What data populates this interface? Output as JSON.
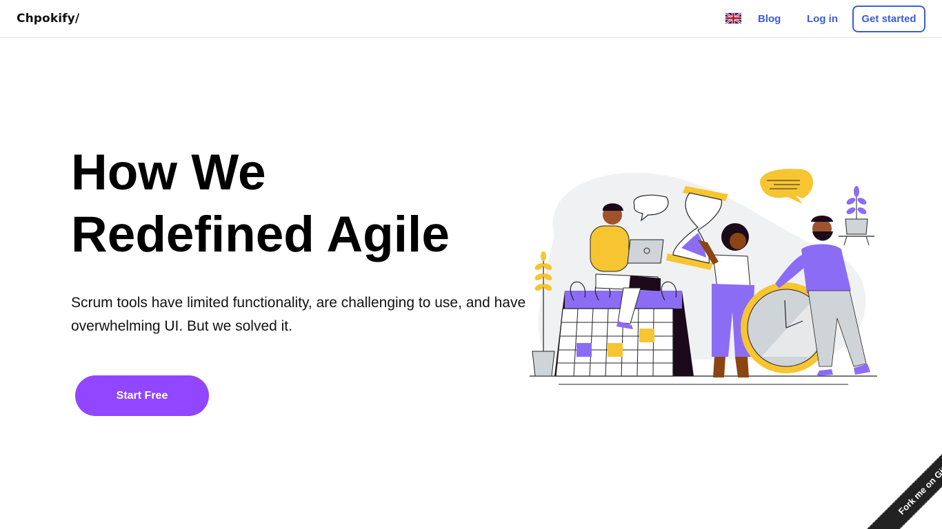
{
  "header": {
    "logo": "Chpokify/",
    "language_icon": "uk-flag-icon",
    "nav": {
      "blog": "Blog",
      "login": "Log in",
      "get_started": "Get started"
    }
  },
  "hero": {
    "title_line1": "How We",
    "title_line2": "Redefined Agile",
    "subtitle": "Scrum tools have limited functionality, are challenging to use, and have overwhelming UI. But we solved it.",
    "cta": "Start Free"
  },
  "ribbon": {
    "label": "Fork me on GitHub"
  },
  "colors": {
    "accent_purple": "#9146ff",
    "link_blue": "#3b5bdb",
    "illustration_purple": "#8b6cf5",
    "illustration_yellow": "#f7c531",
    "ribbon_dark": "#222222"
  }
}
